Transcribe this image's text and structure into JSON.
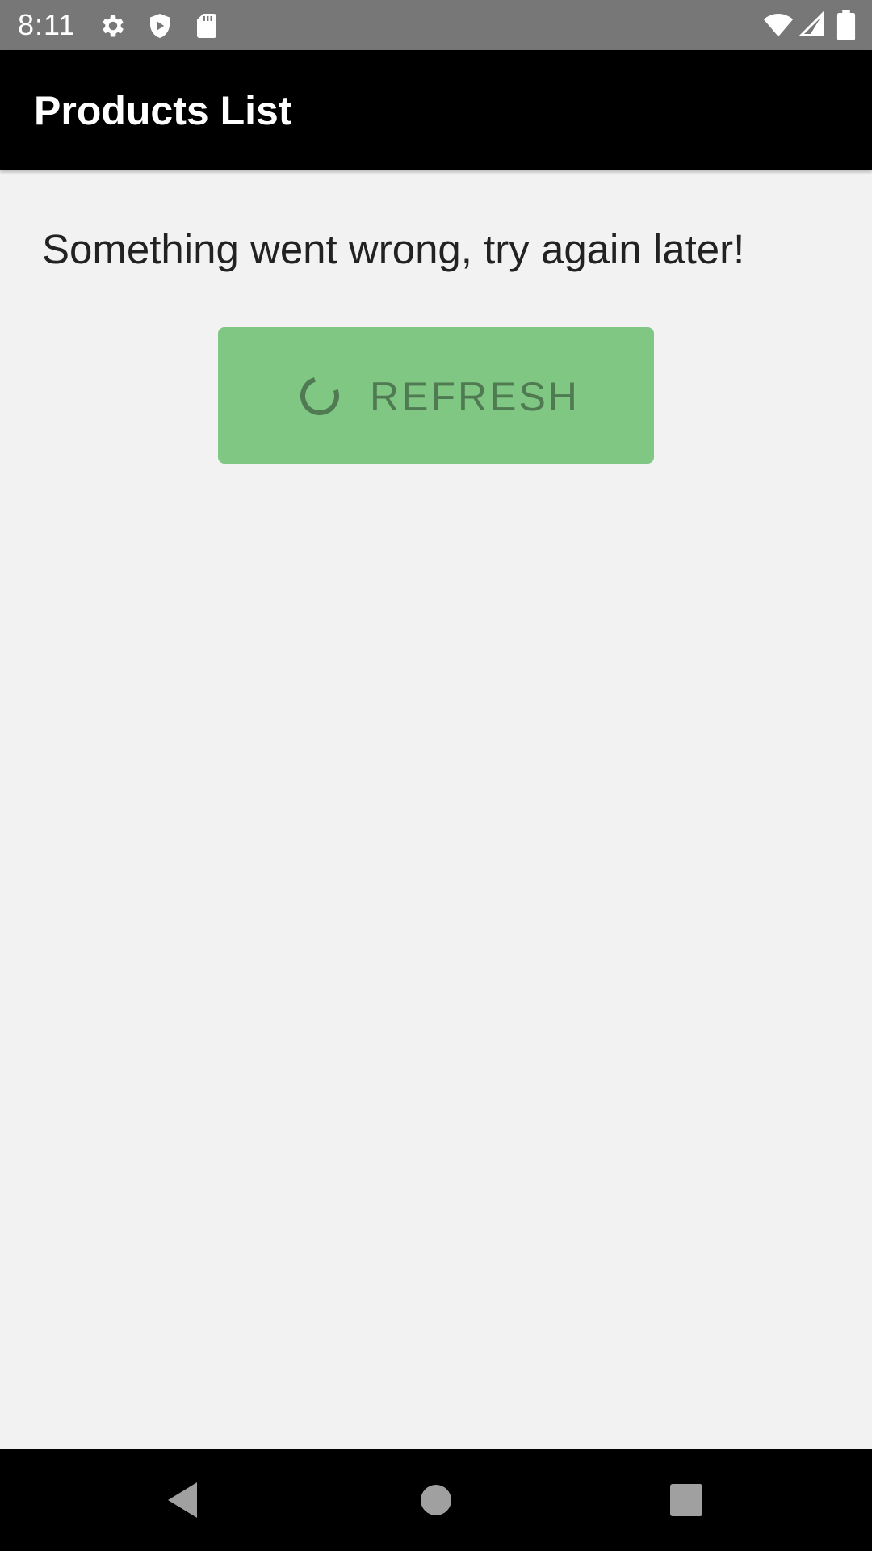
{
  "status_bar": {
    "time": "8:11",
    "icons": [
      "gear-icon",
      "shield-icon",
      "sd-card-icon",
      "wifi-icon",
      "signal-icon",
      "battery-icon"
    ]
  },
  "app_bar": {
    "title": "Products List"
  },
  "content": {
    "error_message": "Something went wrong, try again later!",
    "refresh_button": {
      "label": "REFRESH",
      "icon": "loading-spinner-icon",
      "background_color": "#81c784",
      "text_color": "#4f7a52"
    }
  },
  "nav_bar": {
    "buttons": [
      "back-icon",
      "home-icon",
      "recents-icon"
    ]
  },
  "colors": {
    "status_bar": "#777777",
    "app_bar": "#000000",
    "background": "#f2f2f2"
  }
}
